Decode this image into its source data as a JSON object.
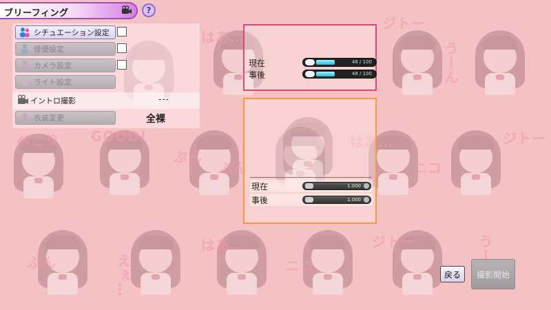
{
  "header": {
    "title": "ブリーフィング",
    "camera_icon": "camera-icon",
    "help_label": "?"
  },
  "settings": {
    "items": [
      {
        "label": "シチュエーション設定",
        "icon": "people-icon",
        "state": "active",
        "checkbox": true
      },
      {
        "label": "俳優設定",
        "icon": "person-icon",
        "state": "disabled",
        "checkbox": true
      },
      {
        "label": "カメラ設定",
        "icon": "person-icon",
        "state": "disabled",
        "checkbox": true
      },
      {
        "label": "ライト設定",
        "icon": "light-icon",
        "state": "disabled",
        "checkbox": false
      }
    ],
    "intro": {
      "label": "イントロ撮影",
      "value": "---"
    },
    "costume": {
      "label": "衣装変更",
      "value": "全裸"
    }
  },
  "stats": {
    "rows": [
      {
        "label": "現在",
        "value_text": "48 / 100",
        "fraction": 0.48
      },
      {
        "label": "事後",
        "value_text": "48 / 100",
        "fraction": 0.48
      }
    ]
  },
  "model_params": {
    "rows": [
      {
        "label": "現在",
        "value_text": "1.000"
      },
      {
        "label": "事後",
        "value_text": "1.000"
      }
    ]
  },
  "buttons": {
    "back_label": "戻る",
    "start_label": "撮影開始"
  },
  "background": {
    "words": [
      "はあ…",
      "ジトー",
      "うーん",
      "ぺこり",
      "GOOD!",
      "ぷん",
      "ぷん",
      "はあ…",
      "ジトー",
      "ニコ",
      "はあ…",
      "えぇ…",
      "ジトー",
      "うーん",
      "ぷん",
      "ニコ"
    ]
  },
  "colors": {
    "stat_border": "#e0457a",
    "model_border": "#f39a3b",
    "gauge_fill": "#28b8e0"
  }
}
